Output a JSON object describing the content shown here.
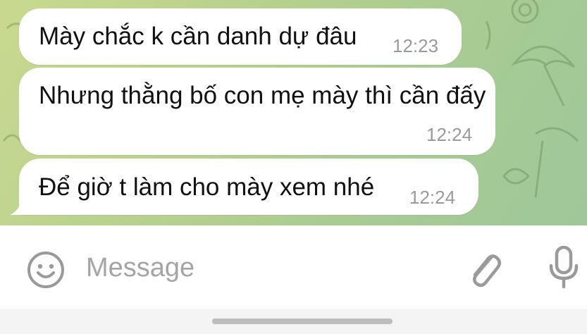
{
  "messages": [
    {
      "text": "Mày chắc k cần danh dự đâu",
      "time": "12:23"
    },
    {
      "text": "Nhưng thằng bố con mẹ mày thì cần đấy",
      "time": "12:24"
    },
    {
      "text": "Để giờ t làm cho mày xem nhé",
      "time": "12:24"
    }
  ],
  "input": {
    "placeholder": "Message"
  },
  "icons": {
    "emoji": "emoji-smile-icon",
    "attach": "paperclip-icon",
    "mic": "microphone-icon"
  },
  "colors": {
    "chat_background": "#b6d08e",
    "bubble": "#ffffff",
    "timestamp": "#9a9a9a",
    "icon_gray": "#9a9a9a",
    "placeholder": "#a5a5a5"
  }
}
